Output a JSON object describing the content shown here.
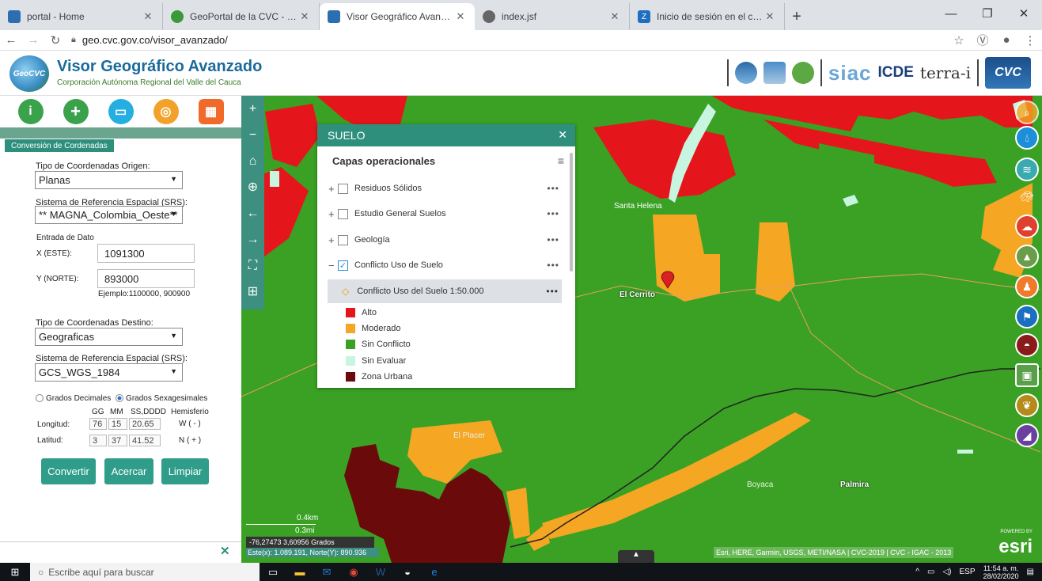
{
  "browser": {
    "tabs": [
      {
        "title": "portal - Home",
        "icon": "portal-favicon",
        "color": "#2c6fb0"
      },
      {
        "title": "GeoPortal de la CVC - Cambio Cl",
        "icon": "geoportal-favicon",
        "color": "#3a9a3a"
      },
      {
        "title": "Visor Geográfico Avanzado Corp",
        "icon": "visor-favicon",
        "color": "#2c6fb0"
      },
      {
        "title": "index.jsf",
        "icon": "globe-favicon",
        "color": "#666666"
      },
      {
        "title": "Inicio de sesión en el cliente web",
        "icon": "zimbra-favicon",
        "color": "#1f6fbf"
      }
    ],
    "new_tab": "+",
    "url": "geo.cvc.gov.co/visor_avanzado/"
  },
  "header": {
    "logo": "GeoCVC",
    "title": "Visor Geográfico Avanzado",
    "subtitle": "Corporación Autónoma Regional del Valle del Cauca",
    "siac": "siac",
    "icde": "ICDE",
    "terra": "terra-i",
    "cvc": "CVC"
  },
  "panel": {
    "header": "Conversión de Cordenadas",
    "origin_type_label": "Tipo de Coordenadas Origen:",
    "origin_type_value": "Planas",
    "origin_srs_label": "Sistema de Referencia Espacial (SRS):",
    "origin_srs_value": "** MAGNA_Colombia_Oeste**",
    "data_entry_label": "Entrada de Dato",
    "x_label": "X (ESTE):",
    "x_value": "1091300",
    "y_label": "Y (NORTE):",
    "y_value": "893000",
    "example": "Ejemplo:1100000, 900900",
    "dest_type_label": "Tipo de Coordenadas Destino:",
    "dest_type_value": "Geograficas",
    "dest_srs_label": "Sistema de Referencia Espacial (SRS):",
    "dest_srs_value": "GCS_WGS_1984",
    "radio_decimal": "Grados Decimales",
    "radio_sexa": "Grados Sexagesimales",
    "col_gg": "GG",
    "col_mm": "MM",
    "col_ss": "SS,DDDD",
    "col_hemi": "Hemisferio",
    "lon_label": "Longitud:",
    "lon_gg": "76",
    "lon_mm": "15",
    "lon_ss": "20.65",
    "lon_hemi": "W ( - )",
    "lat_label": "Latitud:",
    "lat_gg": "3",
    "lat_mm": "37",
    "lat_ss": "41.52",
    "lat_hemi": "N ( + )",
    "btn_convert": "Convertir",
    "btn_zoom": "Acercar",
    "btn_clear": "Limpiar"
  },
  "map": {
    "places": {
      "santa_helena": "Santa Helena",
      "el_cerrito": "El Cerrito",
      "el_placer": "El Placer",
      "boyaca": "Boyaca",
      "palmira": "Palmira"
    },
    "scale_km": "0.4km",
    "scale_mi": "0.3mi",
    "coords": "-76,27473 3,60956 Grados",
    "este_norte": "Este(x): 1.089.191, Norte(Y): 890.936",
    "attribution": "Esri, HERE, Garmin, USGS, METI/NASA | CVC-2019 | CVC - IGAC - 2013",
    "esri": "esri",
    "powered": "POWERED BY"
  },
  "layers": {
    "title": "SUELO",
    "subtitle": "Capas operacionales",
    "items": [
      {
        "name": "Residuos Sólidos",
        "checked": false,
        "expand": "+"
      },
      {
        "name": "Estudio General Suelos",
        "checked": false,
        "expand": "+"
      },
      {
        "name": "Geología",
        "checked": false,
        "expand": "+"
      },
      {
        "name": "Conflicto Uso de Suelo",
        "checked": true,
        "expand": "−"
      }
    ],
    "sublayer": "Conflicto Uso del Suelo 1:50.000",
    "legend": [
      {
        "label": "Alto",
        "color": "#e5161b"
      },
      {
        "label": "Moderado",
        "color": "#f5a623"
      },
      {
        "label": "Sin Conflicto",
        "color": "#3aa124"
      },
      {
        "label": "Sin Evaluar",
        "color": "#c8f5e0"
      },
      {
        "label": "Zona Urbana",
        "color": "#6b0a0a"
      }
    ]
  },
  "taskbar": {
    "search": "Escribe aquí para buscar",
    "lang": "ESP",
    "time": "11:54 a. m.",
    "date": "28/02/2020"
  }
}
